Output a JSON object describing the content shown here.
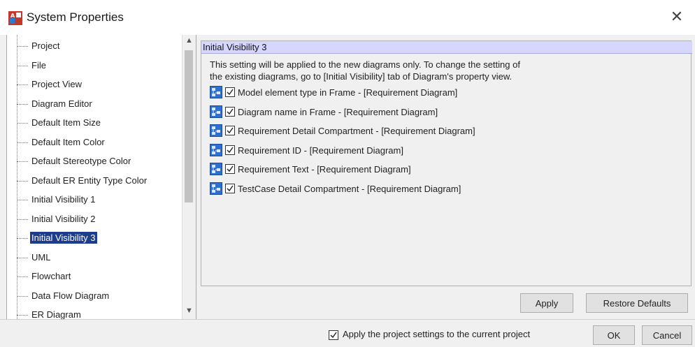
{
  "window": {
    "title": "System Properties",
    "close_glyph": "✕"
  },
  "tree": {
    "items": [
      {
        "label": "Project"
      },
      {
        "label": "File"
      },
      {
        "label": "Project View"
      },
      {
        "label": "Diagram Editor"
      },
      {
        "label": "Default Item Size"
      },
      {
        "label": "Default Item Color"
      },
      {
        "label": "Default Stereotype Color"
      },
      {
        "label": "Default ER Entity Type Color"
      },
      {
        "label": "Initial Visibility 1"
      },
      {
        "label": "Initial Visibility 2"
      },
      {
        "label": "Initial Visibility 3",
        "selected": true
      },
      {
        "label": "UML"
      },
      {
        "label": "Flowchart"
      },
      {
        "label": "Data Flow Diagram"
      },
      {
        "label": "ER Diagram"
      }
    ]
  },
  "panel": {
    "header": "Initial Visibility 3",
    "description_line1": "This setting will be applied to the new diagrams only. To change the setting of",
    "description_line2": "the existing diagrams, go to [Initial Visibility] tab of Diagram's property view.",
    "options": [
      {
        "label": "Model element type in Frame - [Requirement Diagram]",
        "checked": true
      },
      {
        "label": "Diagram name in Frame - [Requirement Diagram]",
        "checked": true
      },
      {
        "label": "Requirement Detail Compartment - [Requirement Diagram]",
        "checked": true
      },
      {
        "label": "Requirement ID - [Requirement Diagram]",
        "checked": true
      },
      {
        "label": "Requirement Text - [Requirement Diagram]",
        "checked": true
      },
      {
        "label": "TestCase Detail Compartment - [Requirement Diagram]",
        "checked": true
      }
    ]
  },
  "buttons": {
    "apply": "Apply",
    "restore_defaults": "Restore Defaults",
    "ok": "OK",
    "cancel": "Cancel"
  },
  "footer": {
    "apply_project_label": "Apply the project settings to the current project",
    "apply_project_checked": true
  },
  "colors": {
    "panel_header_bg": "#d6d6ff",
    "selection_bg": "#1e3c8c",
    "icon_blue": "#1f5fbf"
  }
}
